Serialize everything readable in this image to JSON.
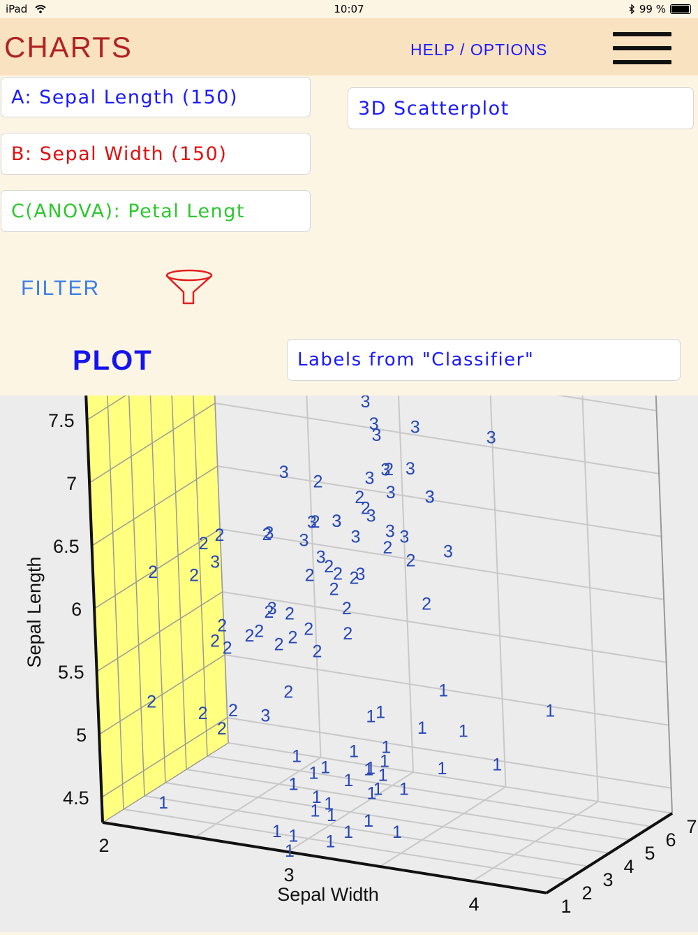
{
  "status": {
    "device": "iPad",
    "time": "10:07",
    "battery": "99 %"
  },
  "header": {
    "title": "CHARTS",
    "help": "HELP / OPTIONS"
  },
  "selectors": {
    "a": "A: Sepal Length (150)",
    "b": "B: Sepal Width (150)",
    "c": "C(ANOVA): Petal Lengt",
    "chart_type": "3D Scatterplot",
    "labels": "Labels from \"Classifier\""
  },
  "filter_label": "FILTER",
  "plot_label": "PLOT",
  "colors": {
    "accent": "#1a1aff",
    "title": "#b22222",
    "a_text": "#1a1aff",
    "b_text": "#e01010",
    "c_text": "#2ec82e",
    "point": "#2546b8",
    "wall": "#ffff80"
  },
  "chart_data": {
    "type": "scatter",
    "projection": "3d",
    "xlabel": "Sepal Width",
    "ylabel": "Sepal Length",
    "zlabel": "",
    "x_ticks": [
      "2",
      "3",
      "4"
    ],
    "y_ticks": [
      "4.5",
      "5",
      "5.5",
      "6",
      "6.5",
      "7",
      "7.5"
    ],
    "z_ticks": [
      "1",
      "2",
      "3",
      "4",
      "5",
      "6",
      "7"
    ],
    "xlim": [
      2,
      4.4
    ],
    "ylim": [
      4.3,
      7.9
    ],
    "zlim": [
      1,
      7
    ],
    "grid": true,
    "point_labels": [
      "1",
      "2",
      "3"
    ],
    "points": [
      {
        "x": 2.3,
        "y": 4.5,
        "z": 1.3,
        "label": "1"
      },
      {
        "x": 2.9,
        "y": 4.4,
        "z": 1.4,
        "label": "1"
      },
      {
        "x": 3.0,
        "y": 4.4,
        "z": 1.3,
        "label": "1"
      },
      {
        "x": 3.0,
        "y": 4.3,
        "z": 1.1,
        "label": "1"
      },
      {
        "x": 3.2,
        "y": 4.4,
        "z": 1.3,
        "label": "1"
      },
      {
        "x": 3.1,
        "y": 4.6,
        "z": 1.5,
        "label": "1"
      },
      {
        "x": 3.2,
        "y": 4.6,
        "z": 1.4,
        "label": "1"
      },
      {
        "x": 3.3,
        "y": 4.5,
        "z": 1.3,
        "label": "1"
      },
      {
        "x": 3.4,
        "y": 4.6,
        "z": 1.4,
        "label": "1"
      },
      {
        "x": 3.6,
        "y": 4.6,
        "z": 1.0,
        "label": "1"
      },
      {
        "x": 3.0,
        "y": 4.8,
        "z": 1.4,
        "label": "1"
      },
      {
        "x": 3.0,
        "y": 4.8,
        "z": 1.4,
        "label": "1"
      },
      {
        "x": 3.1,
        "y": 4.9,
        "z": 1.5,
        "label": "1"
      },
      {
        "x": 3.2,
        "y": 4.7,
        "z": 1.3,
        "label": "1"
      },
      {
        "x": 3.1,
        "y": 4.7,
        "z": 1.6,
        "label": "1"
      },
      {
        "x": 3.3,
        "y": 4.9,
        "z": 1.4,
        "label": "1"
      },
      {
        "x": 3.4,
        "y": 4.8,
        "z": 1.6,
        "label": "1"
      },
      {
        "x": 3.4,
        "y": 5.0,
        "z": 1.5,
        "label": "1"
      },
      {
        "x": 3.5,
        "y": 5.0,
        "z": 1.3,
        "label": "1"
      },
      {
        "x": 3.4,
        "y": 4.8,
        "z": 1.9,
        "label": "1"
      },
      {
        "x": 3.4,
        "y": 4.6,
        "z": 1.4,
        "label": "1"
      },
      {
        "x": 3.6,
        "y": 4.9,
        "z": 1.4,
        "label": "1"
      },
      {
        "x": 3.0,
        "y": 5.0,
        "z": 1.6,
        "label": "1"
      },
      {
        "x": 3.2,
        "y": 5.0,
        "z": 1.2,
        "label": "1"
      },
      {
        "x": 3.4,
        "y": 5.0,
        "z": 1.6,
        "label": "1"
      },
      {
        "x": 3.5,
        "y": 5.1,
        "z": 1.4,
        "label": "1"
      },
      {
        "x": 3.5,
        "y": 5.2,
        "z": 1.5,
        "label": "1"
      },
      {
        "x": 3.3,
        "y": 5.1,
        "z": 1.7,
        "label": "1"
      },
      {
        "x": 3.8,
        "y": 5.1,
        "z": 1.5,
        "label": "1"
      },
      {
        "x": 3.7,
        "y": 5.4,
        "z": 1.5,
        "label": "1"
      },
      {
        "x": 3.9,
        "y": 5.4,
        "z": 1.7,
        "label": "1"
      },
      {
        "x": 4.1,
        "y": 5.2,
        "z": 1.5,
        "label": "1"
      },
      {
        "x": 4.4,
        "y": 5.7,
        "z": 1.5,
        "label": "1"
      },
      {
        "x": 3.5,
        "y": 5.5,
        "z": 1.3,
        "label": "1"
      },
      {
        "x": 3.8,
        "y": 5.7,
        "z": 1.7,
        "label": "1"
      },
      {
        "x": 3.4,
        "y": 5.4,
        "z": 1.7,
        "label": "1"
      },
      {
        "x": 2.0,
        "y": 5.0,
        "z": 3.5,
        "label": "2"
      },
      {
        "x": 2.2,
        "y": 6.2,
        "z": 4.5,
        "label": "2"
      },
      {
        "x": 2.3,
        "y": 5.5,
        "z": 4.0,
        "label": "2"
      },
      {
        "x": 2.3,
        "y": 5.0,
        "z": 3.3,
        "label": "2"
      },
      {
        "x": 2.4,
        "y": 5.5,
        "z": 3.7,
        "label": "2"
      },
      {
        "x": 2.4,
        "y": 4.9,
        "z": 3.3,
        "label": "2"
      },
      {
        "x": 2.5,
        "y": 5.6,
        "z": 3.9,
        "label": "2"
      },
      {
        "x": 2.5,
        "y": 6.3,
        "z": 4.9,
        "label": "2"
      },
      {
        "x": 2.6,
        "y": 5.5,
        "z": 4.4,
        "label": "2"
      },
      {
        "x": 2.7,
        "y": 5.8,
        "z": 4.1,
        "label": "2"
      },
      {
        "x": 2.7,
        "y": 5.2,
        "z": 3.9,
        "label": "2"
      },
      {
        "x": 2.8,
        "y": 5.7,
        "z": 4.1,
        "label": "2"
      },
      {
        "x": 2.9,
        "y": 6.0,
        "z": 4.5,
        "label": "2"
      },
      {
        "x": 2.9,
        "y": 5.6,
        "z": 3.6,
        "label": "2"
      },
      {
        "x": 2.9,
        "y": 6.1,
        "z": 4.7,
        "label": "2"
      },
      {
        "x": 3.0,
        "y": 5.9,
        "z": 4.2,
        "label": "2"
      },
      {
        "x": 3.0,
        "y": 6.1,
        "z": 4.6,
        "label": "2"
      },
      {
        "x": 2.8,
        "y": 6.5,
        "z": 4.6,
        "label": "2"
      },
      {
        "x": 3.1,
        "y": 6.7,
        "z": 4.4,
        "label": "2"
      },
      {
        "x": 3.2,
        "y": 7.0,
        "z": 4.7,
        "label": "2"
      },
      {
        "x": 3.2,
        "y": 6.4,
        "z": 4.5,
        "label": "2"
      },
      {
        "x": 3.3,
        "y": 6.3,
        "z": 4.7,
        "label": "2"
      },
      {
        "x": 3.4,
        "y": 6.0,
        "z": 4.5,
        "label": "2"
      },
      {
        "x": 2.2,
        "y": 6.0,
        "z": 4.0,
        "label": "2"
      },
      {
        "x": 2.7,
        "y": 6.0,
        "z": 5.1,
        "label": "2"
      },
      {
        "x": 2.6,
        "y": 5.8,
        "z": 4.0,
        "label": "2"
      },
      {
        "x": 2.8,
        "y": 6.8,
        "z": 4.8,
        "label": "2"
      },
      {
        "x": 2.5,
        "y": 5.1,
        "z": 3.0,
        "label": "2"
      },
      {
        "x": 2.4,
        "y": 5.7,
        "z": 3.5,
        "label": "2"
      },
      {
        "x": 2.0,
        "y": 6.0,
        "z": 3.8,
        "label": "2"
      },
      {
        "x": 3.0,
        "y": 6.7,
        "z": 5.0,
        "label": "2"
      },
      {
        "x": 2.9,
        "y": 6.2,
        "z": 4.3,
        "label": "2"
      },
      {
        "x": 3.0,
        "y": 5.7,
        "z": 4.2,
        "label": "2"
      },
      {
        "x": 2.6,
        "y": 5.7,
        "z": 3.5,
        "label": "2"
      },
      {
        "x": 2.3,
        "y": 6.3,
        "z": 4.4,
        "label": "2"
      },
      {
        "x": 2.7,
        "y": 5.6,
        "z": 4.2,
        "label": "2"
      },
      {
        "x": 2.5,
        "y": 4.9,
        "z": 4.5,
        "label": "3"
      },
      {
        "x": 2.2,
        "y": 6.0,
        "z": 5.0,
        "label": "3"
      },
      {
        "x": 2.5,
        "y": 6.3,
        "z": 5.0,
        "label": "3"
      },
      {
        "x": 2.5,
        "y": 6.7,
        "z": 5.8,
        "label": "3"
      },
      {
        "x": 2.5,
        "y": 5.7,
        "z": 5.0,
        "label": "3"
      },
      {
        "x": 2.6,
        "y": 7.7,
        "z": 6.9,
        "label": "3"
      },
      {
        "x": 2.7,
        "y": 6.3,
        "z": 4.9,
        "label": "3"
      },
      {
        "x": 2.8,
        "y": 7.4,
        "z": 6.1,
        "label": "3"
      },
      {
        "x": 2.8,
        "y": 6.2,
        "z": 4.8,
        "label": "3"
      },
      {
        "x": 2.9,
        "y": 7.3,
        "z": 6.3,
        "label": "3"
      },
      {
        "x": 3.0,
        "y": 7.7,
        "z": 6.1,
        "label": "3"
      },
      {
        "x": 3.0,
        "y": 6.5,
        "z": 5.5,
        "label": "3"
      },
      {
        "x": 3.0,
        "y": 7.2,
        "z": 5.8,
        "label": "3"
      },
      {
        "x": 3.1,
        "y": 6.9,
        "z": 5.4,
        "label": "3"
      },
      {
        "x": 3.2,
        "y": 7.2,
        "z": 6.0,
        "label": "3"
      },
      {
        "x": 3.3,
        "y": 6.7,
        "z": 5.7,
        "label": "3"
      },
      {
        "x": 3.4,
        "y": 6.3,
        "z": 5.6,
        "label": "3"
      },
      {
        "x": 3.6,
        "y": 7.2,
        "z": 6.1,
        "label": "3"
      },
      {
        "x": 3.8,
        "y": 7.7,
        "z": 6.7,
        "label": "3"
      },
      {
        "x": 3.8,
        "y": 7.9,
        "z": 6.4,
        "label": "3"
      },
      {
        "x": 3.0,
        "y": 6.8,
        "z": 5.5,
        "label": "3"
      },
      {
        "x": 3.1,
        "y": 6.4,
        "z": 5.5,
        "label": "3"
      },
      {
        "x": 3.2,
        "y": 6.9,
        "z": 5.7,
        "label": "3"
      },
      {
        "x": 2.8,
        "y": 6.4,
        "z": 5.6,
        "label": "3"
      },
      {
        "x": 3.2,
        "y": 6.4,
        "z": 5.3,
        "label": "3"
      },
      {
        "x": 2.7,
        "y": 6.4,
        "z": 5.3,
        "label": "3"
      },
      {
        "x": 3.0,
        "y": 7.1,
        "z": 5.9,
        "label": "3"
      },
      {
        "x": 2.9,
        "y": 6.3,
        "z": 5.6,
        "label": "3"
      },
      {
        "x": 3.0,
        "y": 6.1,
        "z": 4.9,
        "label": "3"
      },
      {
        "x": 2.8,
        "y": 7.7,
        "z": 6.7,
        "label": "3"
      },
      {
        "x": 2.8,
        "y": 6.4,
        "z": 5.6,
        "label": "3"
      },
      {
        "x": 3.1,
        "y": 6.7,
        "z": 5.6,
        "label": "3"
      },
      {
        "x": 3.3,
        "y": 6.7,
        "z": 5.7,
        "label": "3"
      }
    ]
  }
}
